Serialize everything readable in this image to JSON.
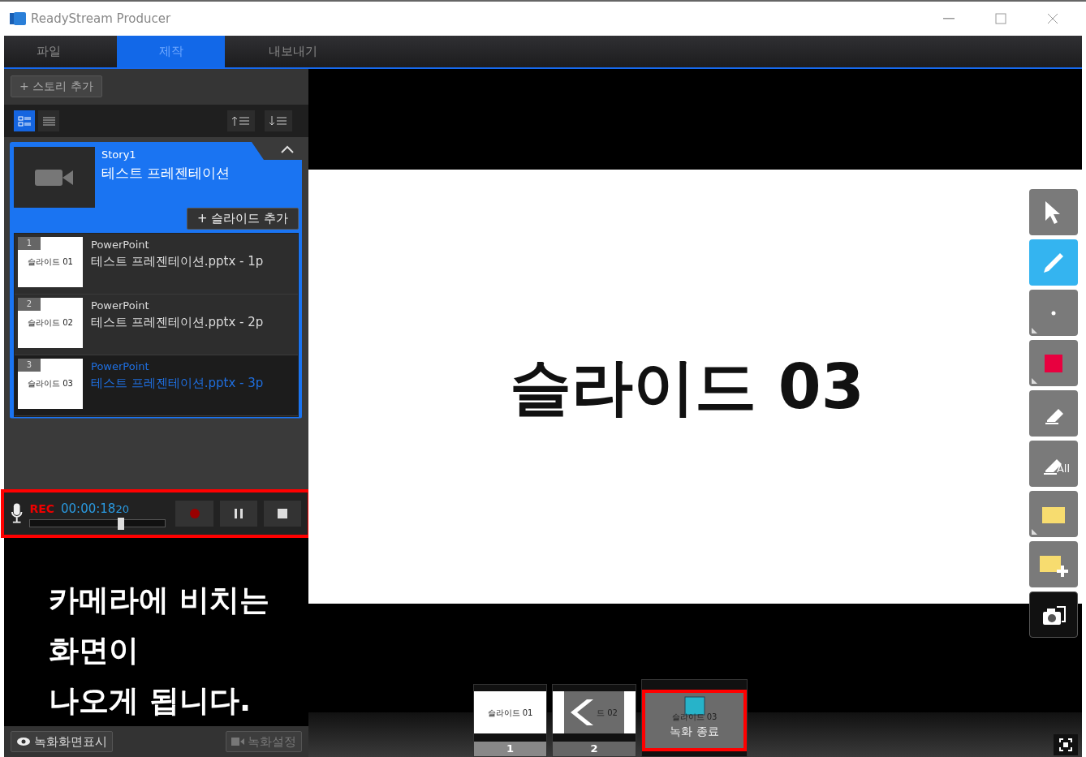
{
  "window": {
    "title": "ReadyStream Producer"
  },
  "tabs": [
    {
      "label": "파일",
      "selected": false
    },
    {
      "label": "제작",
      "selected": true
    },
    {
      "label": "내보내기",
      "selected": false
    }
  ],
  "left_panel": {
    "add_story_button": "+ 스토리 추가",
    "view_modes": [
      {
        "kind": "detail",
        "selected": true
      },
      {
        "kind": "list",
        "selected": false
      }
    ],
    "story": {
      "label": "Story1",
      "title": "테스트 프레젠테이션",
      "add_slide_button": "+ 슬라이드 추가",
      "expanded": true,
      "slides": [
        {
          "number": "1",
          "thumb_text": "슬라이드 01",
          "source": "PowerPoint",
          "title": "테스트 프레젠테이션.pptx - 1p",
          "selected": false
        },
        {
          "number": "2",
          "thumb_text": "슬라이드 02",
          "source": "PowerPoint",
          "title": "테스트 프레젠테이션.pptx - 2p",
          "selected": false
        },
        {
          "number": "3",
          "thumb_text": "슬라이드 03",
          "source": "PowerPoint",
          "title": "테스트 프레젠테이션.pptx - 3p",
          "selected": true
        }
      ]
    },
    "recorder": {
      "rec_label": "REC",
      "time": "00:00:18",
      "time_fraction": "20",
      "level": 0.67
    },
    "camera_text": [
      "카메라에 비치는",
      "화면이",
      "나오게 됩니다."
    ],
    "show_recording_button": "녹화화면표시",
    "record_settings_button": "녹화설정"
  },
  "slide": {
    "text": "슬라이드 03"
  },
  "tools": [
    {
      "kind": "pointer",
      "selected": false,
      "menu": false
    },
    {
      "kind": "pen",
      "selected": true,
      "menu": false
    },
    {
      "kind": "dot",
      "selected": false,
      "menu": true
    },
    {
      "kind": "color",
      "selected": false,
      "menu": true,
      "color": "#e8003f"
    },
    {
      "kind": "eraser",
      "selected": false,
      "menu": false
    },
    {
      "kind": "erase-all",
      "selected": false,
      "menu": false,
      "label": "All"
    },
    {
      "kind": "note",
      "selected": false,
      "menu": true
    },
    {
      "kind": "note-add",
      "selected": false,
      "menu": false
    },
    {
      "kind": "camera",
      "selected": false,
      "menu": false
    }
  ],
  "filmstrip": [
    {
      "thumb_text": "슬라이드 01",
      "number": "1",
      "kind": "slide"
    },
    {
      "thumb_text": "드 02",
      "number": "2",
      "kind": "back"
    },
    {
      "thumb_text": "슬라이드 03",
      "label": "녹화 종료",
      "kind": "stop"
    }
  ]
}
